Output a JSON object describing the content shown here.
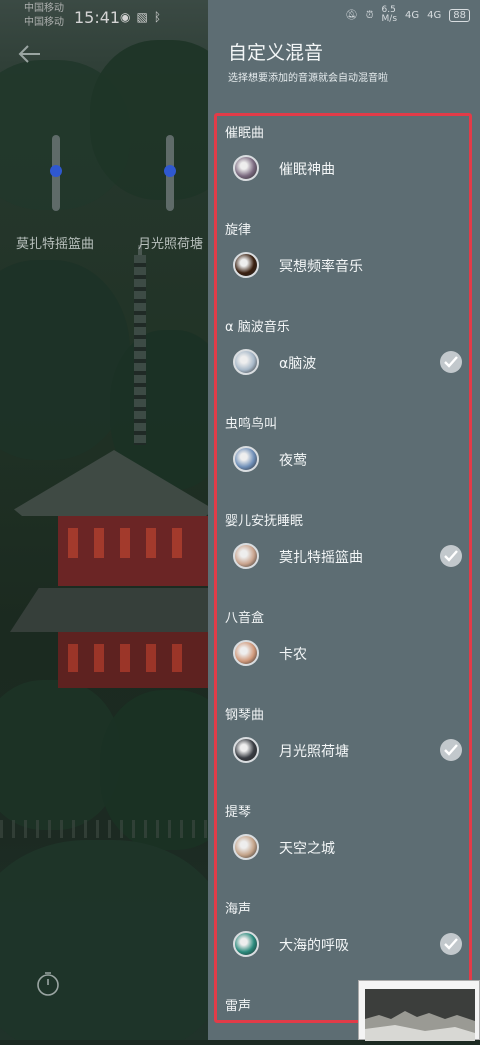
{
  "status_bar": {
    "carrier_left_1": "中国移动",
    "carrier_left_2": "中国移动",
    "time": "15:41",
    "speed": "6.5",
    "speed_unit": "M/s",
    "net_1": "4G",
    "net_2": "4G",
    "battery": "88"
  },
  "background": {
    "slider_1_label": "莫扎特摇篮曲",
    "slider_2_label": "月光照荷塘",
    "slider_1_level": 0.5,
    "slider_2_level": 0.5
  },
  "panel": {
    "title": "自定义混音",
    "subtitle": "选择想要添加的音源就会自动混音啦"
  },
  "categories": [
    {
      "label": "催眠曲",
      "item": "催眠神曲",
      "selected": false,
      "icon": "moon-disc-icon",
      "color": "#7b6a80"
    },
    {
      "label": "旋律",
      "item": "冥想频率音乐",
      "selected": false,
      "icon": "orb-disc-icon",
      "color": "#3a2010"
    },
    {
      "label": "α 脑波音乐",
      "item": "α脑波",
      "selected": true,
      "icon": "wave-disc-icon",
      "color": "#a7b8c8"
    },
    {
      "label": "虫鸣鸟叫",
      "item": "夜莺",
      "selected": false,
      "icon": "bird-disc-icon",
      "color": "#6f8fb8"
    },
    {
      "label": "婴儿安抚睡眠",
      "item": "莫扎特摇篮曲",
      "selected": true,
      "icon": "baby-disc-icon",
      "color": "#c9a48e"
    },
    {
      "label": "八音盒",
      "item": "卡农",
      "selected": false,
      "icon": "musicbox-disc-icon",
      "color": "#d19a7c"
    },
    {
      "label": "钢琴曲",
      "item": "月光照荷塘",
      "selected": true,
      "icon": "piano-disc-icon",
      "color": "#3a3e44"
    },
    {
      "label": "提琴",
      "item": "天空之城",
      "selected": false,
      "icon": "violin-disc-icon",
      "color": "#c4a48a"
    },
    {
      "label": "海声",
      "item": "大海的呼吸",
      "selected": true,
      "icon": "sea-disc-icon",
      "color": "#2a8a7c"
    },
    {
      "label": "雷声"
    }
  ]
}
